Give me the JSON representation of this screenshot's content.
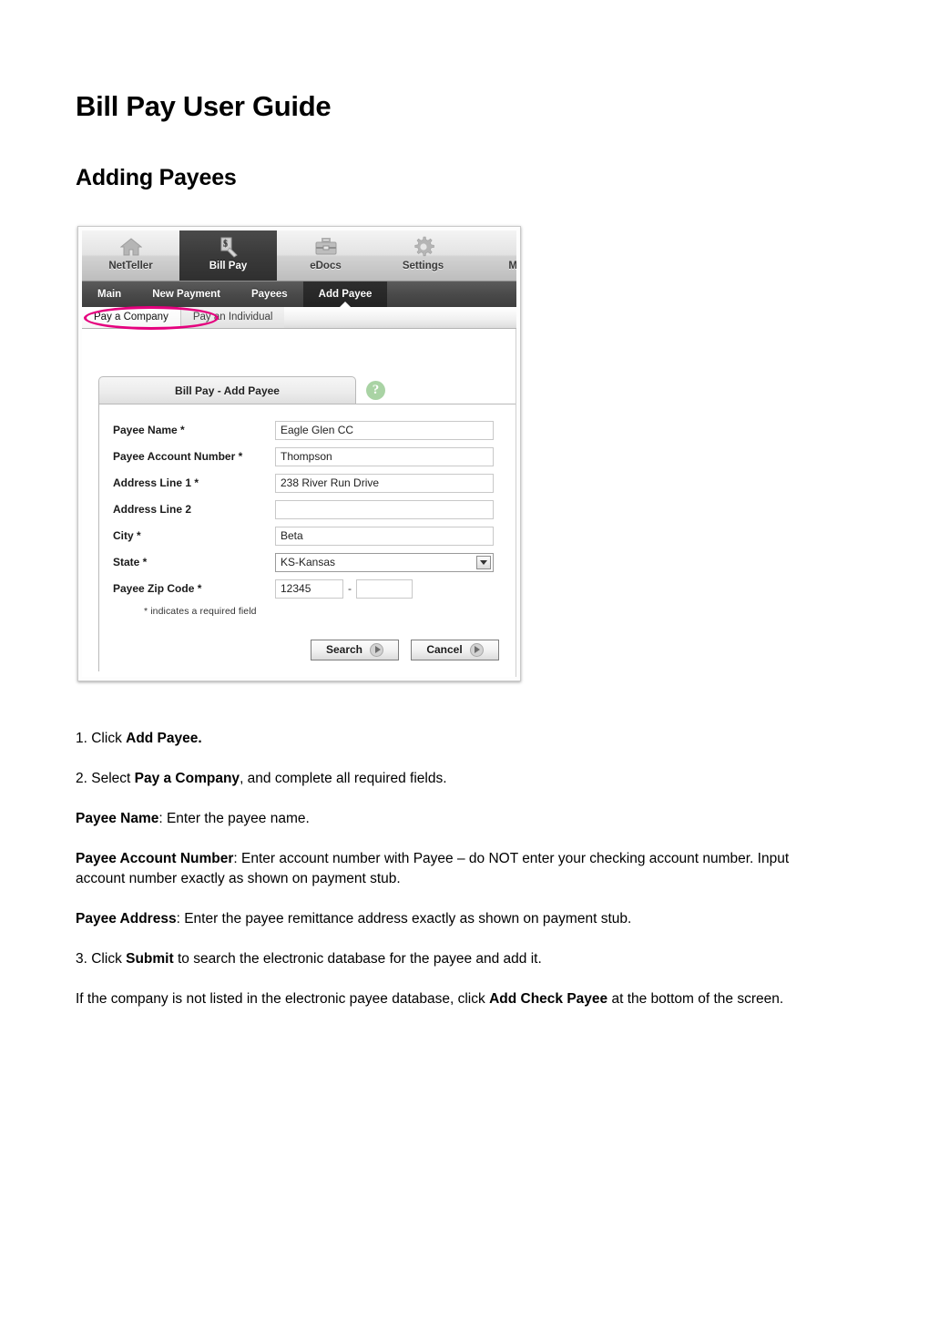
{
  "document": {
    "title": "Bill Pay User Guide",
    "subtitle": "Adding Payees"
  },
  "screenshot": {
    "topnav": {
      "items": [
        {
          "label": "NetTeller",
          "icon": "home-icon",
          "active": false
        },
        {
          "label": "Bill Pay",
          "icon": "check-tag-icon",
          "active": true
        },
        {
          "label": "eDocs",
          "icon": "briefcase-icon",
          "active": false
        },
        {
          "label": "Settings",
          "icon": "gear-icon",
          "active": false
        },
        {
          "label": "My F",
          "icon": "clipped-icon",
          "active": false
        }
      ]
    },
    "subnav": {
      "items": [
        {
          "label": "Main",
          "active": false
        },
        {
          "label": "New Payment",
          "active": false
        },
        {
          "label": "Payees",
          "active": false
        },
        {
          "label": "Add Payee",
          "active": true
        }
      ]
    },
    "tabs": {
      "items": [
        {
          "label": "Pay a Company",
          "active": true
        },
        {
          "label": "Pay an Individual",
          "active": false
        }
      ]
    },
    "panel": {
      "header": "Bill Pay - Add Payee",
      "help_icon_glyph": "?",
      "required_note": "* indicates a required field",
      "fields": [
        {
          "label": "Payee Name *",
          "value": "Eagle Glen CC",
          "type": "text"
        },
        {
          "label": "Payee Account Number *",
          "value": "Thompson",
          "type": "text"
        },
        {
          "label": "Address Line 1 *",
          "value": "238 River Run Drive",
          "type": "text"
        },
        {
          "label": "Address Line 2",
          "value": "",
          "type": "text"
        },
        {
          "label": "City *",
          "value": "Beta",
          "type": "text"
        },
        {
          "label": "State *",
          "value": "KS-Kansas",
          "type": "select"
        }
      ],
      "zip": {
        "label": "Payee Zip Code *",
        "value_primary": "12345",
        "separator": "-",
        "value_extension": ""
      },
      "buttons": [
        {
          "label": "Search"
        },
        {
          "label": "Cancel"
        }
      ]
    },
    "annotation": {
      "shape": "ellipse",
      "color": "#e5007e",
      "target": "Pay a Company"
    },
    "clipped_fragments": [
      "P",
      "I"
    ]
  },
  "body": {
    "paragraphs": [
      {
        "segments": [
          {
            "text": "1. Click ",
            "bold": false
          },
          {
            "text": "Add Payee.",
            "bold": true
          }
        ]
      },
      {
        "segments": [
          {
            "text": "2. Select ",
            "bold": false
          },
          {
            "text": "Pay a Company",
            "bold": true
          },
          {
            "text": ", and complete all required fields.",
            "bold": false
          }
        ]
      },
      {
        "segments": [
          {
            "text": "Payee Name",
            "bold": true
          },
          {
            "text": ": Enter the payee name.",
            "bold": false
          }
        ]
      },
      {
        "segments": [
          {
            "text": "Payee Account Number",
            "bold": true
          },
          {
            "text": ": Enter account number with Payee – do NOT enter your checking account number. Input account number exactly as shown on payment stub.",
            "bold": false
          }
        ]
      },
      {
        "segments": [
          {
            "text": "Payee Address",
            "bold": true
          },
          {
            "text": ": Enter the payee remittance address exactly as shown on payment stub.",
            "bold": false
          }
        ]
      },
      {
        "segments": [
          {
            "text": "3. Click ",
            "bold": false
          },
          {
            "text": "Submit",
            "bold": true
          },
          {
            "text": " to search the electronic database for the payee and add it.",
            "bold": false
          }
        ]
      },
      {
        "segments": [
          {
            "text": "If the company is not listed in the electronic payee database, click ",
            "bold": false
          },
          {
            "text": "Add Check Payee",
            "bold": true
          },
          {
            "text": " at the bottom of the screen.",
            "bold": false
          }
        ]
      }
    ]
  }
}
